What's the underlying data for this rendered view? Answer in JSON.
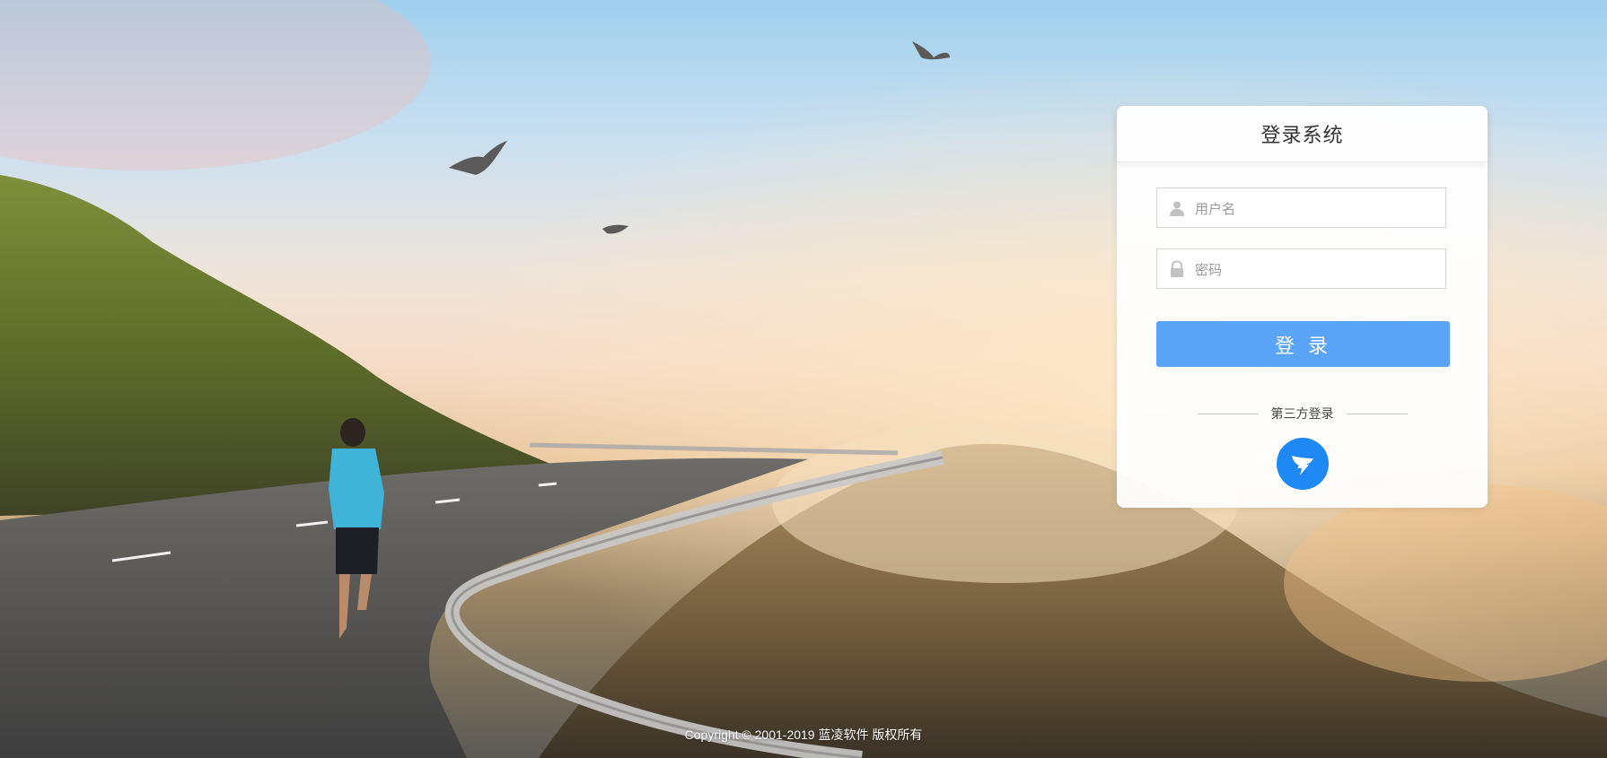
{
  "login": {
    "title": "登录系统",
    "username_placeholder": "用户名",
    "username_value": "",
    "password_placeholder": "密码",
    "password_value": "",
    "submit_label": "登 录",
    "third_party_label": "第三方登录",
    "third_party_icon": "dingtalk-icon"
  },
  "footer": {
    "copyright": "Copyright © 2001-2019 蓝凌软件 版权所有"
  },
  "colors": {
    "accent": "#5aa4f7",
    "dingtalk": "#1e88f5"
  }
}
